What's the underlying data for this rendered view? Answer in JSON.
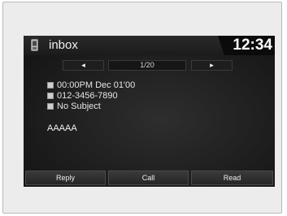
{
  "header": {
    "title": "inbox",
    "clock": "12:34",
    "icon": "phone-icon"
  },
  "navigation": {
    "prev_label": "◂",
    "next_label": "▸",
    "page_indicator": "1/20"
  },
  "message": {
    "datetime": "00:00PM Dec 01'00",
    "sender": "012-3456-7890",
    "subject": "No Subject",
    "body": "AAAAA"
  },
  "actions": {
    "reply_label": "Reply",
    "call_label": "Call",
    "read_label": "Read"
  },
  "colors": {
    "screen_background": "#1a1a1a",
    "text": "#e6e6e6",
    "frame": "#ececec"
  }
}
